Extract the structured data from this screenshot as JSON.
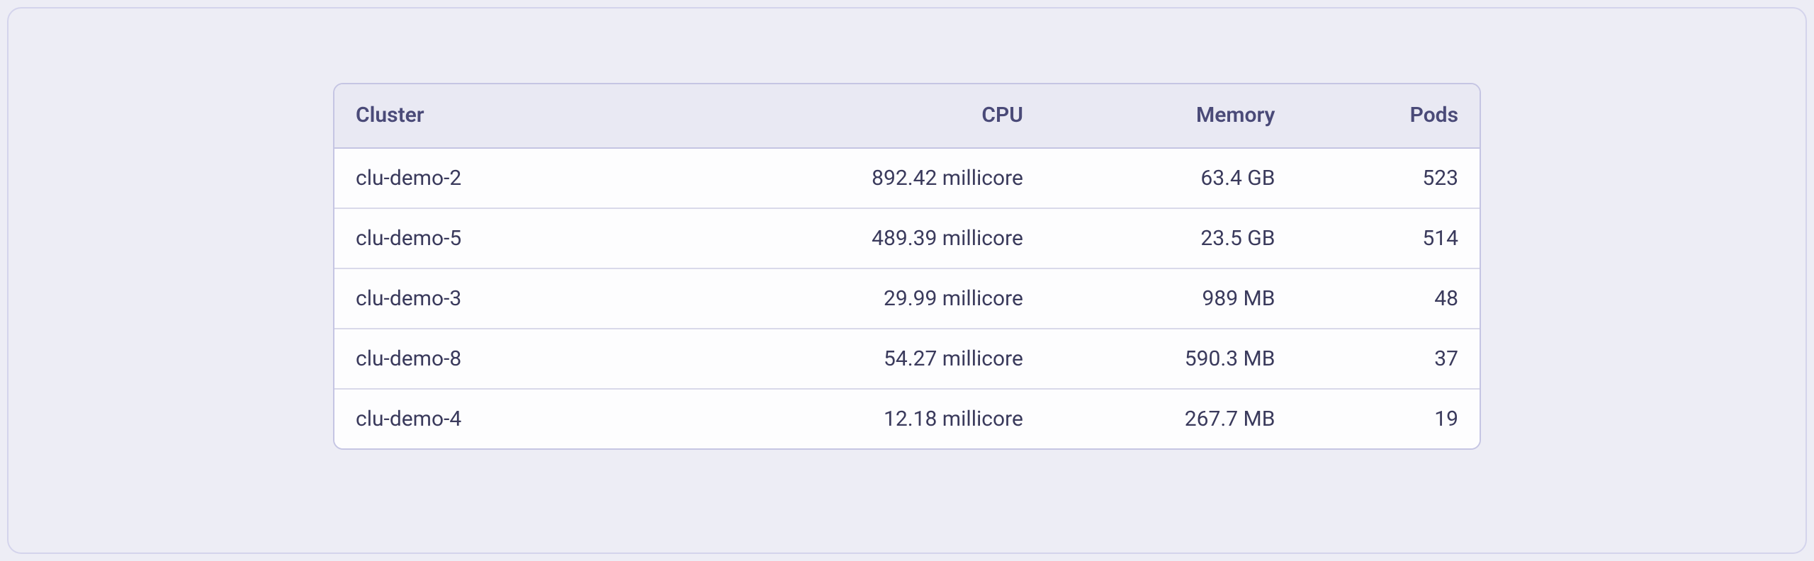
{
  "table": {
    "headers": {
      "cluster": "Cluster",
      "cpu": "CPU",
      "memory": "Memory",
      "pods": "Pods"
    },
    "rows": [
      {
        "cluster": "clu-demo-2",
        "cpu": "892.42 millicore",
        "memory": "63.4 GB",
        "pods": "523"
      },
      {
        "cluster": "clu-demo-5",
        "cpu": "489.39 millicore",
        "memory": "23.5 GB",
        "pods": "514"
      },
      {
        "cluster": "clu-demo-3",
        "cpu": "29.99 millicore",
        "memory": "989 MB",
        "pods": "48"
      },
      {
        "cluster": "clu-demo-8",
        "cpu": "54.27 millicore",
        "memory": "590.3 MB",
        "pods": "37"
      },
      {
        "cluster": "clu-demo-4",
        "cpu": "12.18 millicore",
        "memory": "267.7 MB",
        "pods": "19"
      }
    ]
  }
}
